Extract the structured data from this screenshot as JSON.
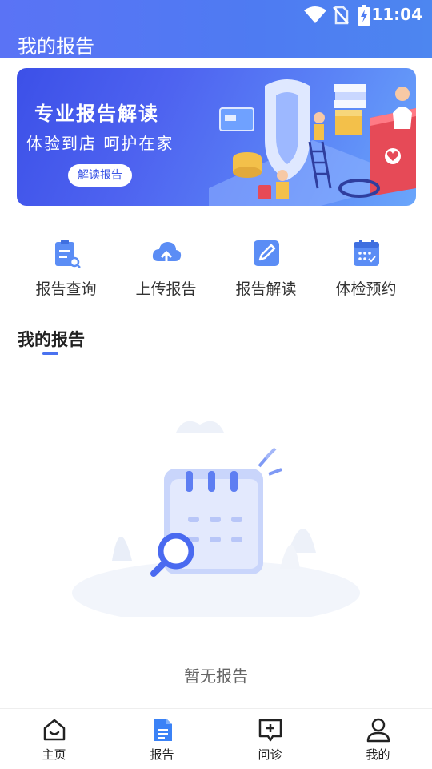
{
  "status_bar": {
    "time": "11:04"
  },
  "header": {
    "title": "我的报告"
  },
  "banner": {
    "title": "专业报告解读",
    "subtitle": "体验到店 呵护在家",
    "button_label": "解读报告"
  },
  "quick_actions": [
    {
      "label": "报告查询",
      "icon": "report-search-icon"
    },
    {
      "label": "上传报告",
      "icon": "cloud-upload-icon"
    },
    {
      "label": "报告解读",
      "icon": "edit-note-icon"
    },
    {
      "label": "体检预约",
      "icon": "calendar-icon"
    }
  ],
  "section": {
    "title": "我的报告"
  },
  "empty_state": {
    "text": "暂无报告"
  },
  "tabbar": {
    "items": [
      {
        "label": "主页",
        "icon": "home-icon"
      },
      {
        "label": "报告",
        "icon": "report-doc-icon",
        "active": true
      },
      {
        "label": "问诊",
        "icon": "consult-icon"
      },
      {
        "label": "我的",
        "icon": "profile-icon"
      }
    ]
  },
  "colors": {
    "primary": "#4e7bf2",
    "icon_blue": "#5b8df5",
    "active_tab": "#3b82f6"
  }
}
